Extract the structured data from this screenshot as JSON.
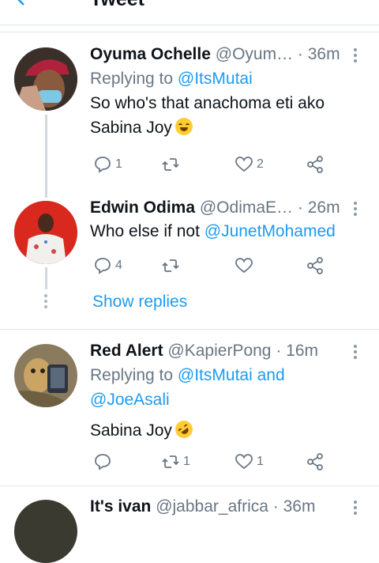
{
  "header": {
    "back_icon": "arrow-left-icon",
    "title": "Tweet"
  },
  "tweets": [
    {
      "name": "Oyuma Ochelle",
      "handle": "@Oyum…",
      "time": "· 36m",
      "reply_label": "Replying to",
      "reply_to": "@ItsMutai",
      "reply_to_2": "",
      "text_line1": "So who's that anachoma eti ako",
      "text_line2": "Sabina Joy",
      "emoji": "tears-of-joy-emoji",
      "replies": "1",
      "retweets": "",
      "likes": "2"
    },
    {
      "name": "Edwin Odima",
      "handle": "@OdimaE…",
      "time": "· 26m",
      "text_prefix": "Who else if not",
      "mention": "@JunetMohamed",
      "replies": "4",
      "retweets": "",
      "likes": "",
      "show_replies": "Show replies"
    },
    {
      "name": "Red Alert",
      "handle": "@KapierPong",
      "time": "· 16m",
      "reply_label": "Replying to",
      "reply_to": "@ItsMutai and",
      "reply_to_2": "@JoeAsali",
      "text_line1": "Sabina Joy",
      "emoji": "rolling-laughing-emoji",
      "replies": "",
      "retweets": "1",
      "likes": "1"
    },
    {
      "name": "It's ivan",
      "handle": "@jabbar_africa",
      "time": "· 36m"
    }
  ]
}
